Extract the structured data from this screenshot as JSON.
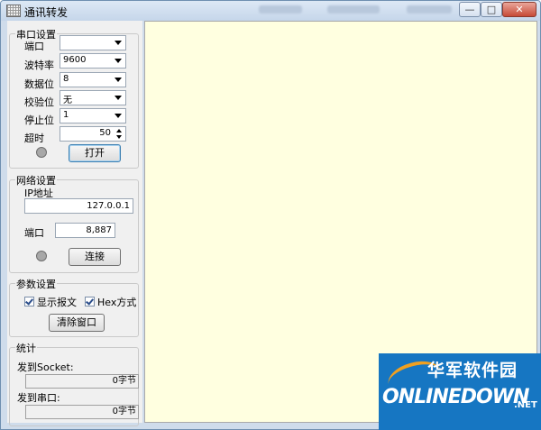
{
  "window": {
    "title": "通讯转发",
    "min_glyph": "—",
    "max_glyph": "□",
    "close_glyph": "✕"
  },
  "serial": {
    "group_title": "串口设置",
    "port_label": "端口",
    "port_value": "",
    "baud_label": "波特率",
    "baud_value": "9600",
    "databits_label": "数据位",
    "databits_value": "8",
    "parity_label": "校验位",
    "parity_value": "无",
    "stopbits_label": "停止位",
    "stopbits_value": "1",
    "timeout_label": "超时",
    "timeout_value": "50",
    "open_button": "打开"
  },
  "network": {
    "group_title": "网络设置",
    "ip_label": "IP地址",
    "ip_value": "127.0.0.1",
    "port_label": "端口",
    "port_value": "8,887",
    "connect_button": "连接"
  },
  "params": {
    "group_title": "参数设置",
    "show_message_label": "显示报文",
    "show_message_checked": true,
    "hex_label": "Hex方式",
    "hex_checked": true,
    "clear_button": "清除窗口"
  },
  "stats": {
    "group_title": "统计",
    "to_socket_label": "发到Socket:",
    "to_socket_value": "0字节",
    "to_serial_label": "发到串口:",
    "to_serial_value": "0字节"
  },
  "watermark": {
    "cn": "华军软件园",
    "en": "ONLINEDOWN",
    "net": ".NET"
  },
  "colors": {
    "log_background": "#ffffe0",
    "panel": "#f0f0f0",
    "watermark_blue": "#1676c2"
  }
}
